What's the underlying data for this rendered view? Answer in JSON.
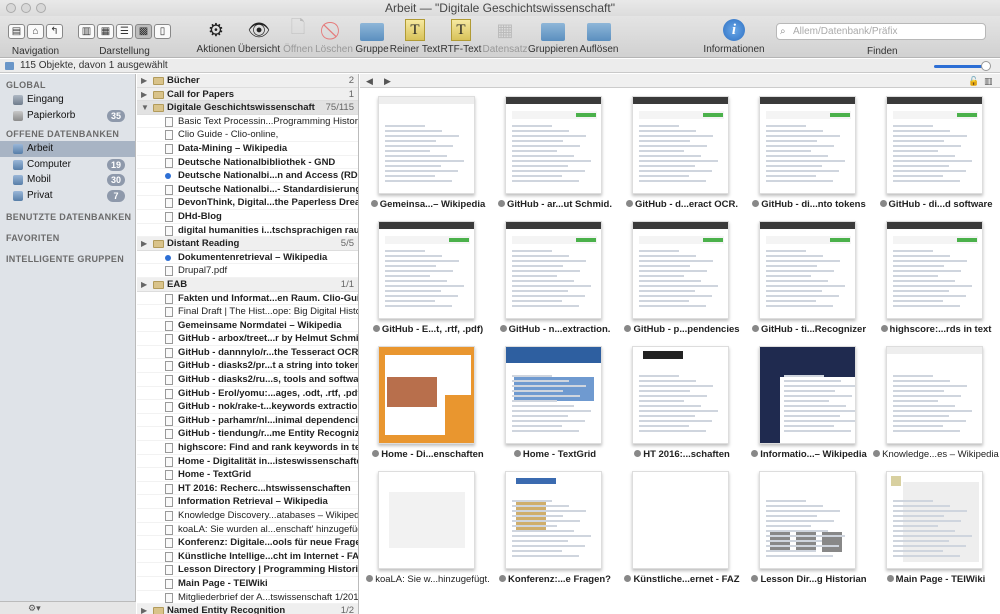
{
  "window": {
    "title": "Arbeit — \"Digitale Geschichtswissenschaft\""
  },
  "toolbar": {
    "navigation": "Navigation",
    "darstellung": "Darstellung",
    "aktionen": "Aktionen",
    "uebersicht": "Übersicht",
    "oeffnen": "Öffnen",
    "loeschen": "Löschen",
    "gruppe": "Gruppe",
    "reiner_text": "Reiner Text",
    "rtf_text": "RTF-Text",
    "datensatz": "Datensatz",
    "gruppieren": "Gruppieren",
    "aufloesen": "Auflösen",
    "informationen": "Informationen",
    "finden": "Finden",
    "search_placeholder": "Allem/Datenbank/Präfix"
  },
  "pathbar": {
    "status": "115 Objekte, davon 1 ausgewählt"
  },
  "sidebar": {
    "global_head": "GLOBAL",
    "global": [
      {
        "label": "Eingang",
        "badge": ""
      },
      {
        "label": "Papierkorb",
        "badge": "35"
      }
    ],
    "offene_head": "OFFENE DATENBANKEN",
    "offene": [
      {
        "label": "Arbeit",
        "badge": ""
      },
      {
        "label": "Computer",
        "badge": "19"
      },
      {
        "label": "Mobil",
        "badge": "30"
      },
      {
        "label": "Privat",
        "badge": "7"
      }
    ],
    "benutzte_head": "BENUTZTE DATENBANKEN",
    "favoriten_head": "FAVORITEN",
    "intelligente_head": "INTELLIGENTE GRUPPEN"
  },
  "list": [
    {
      "label": "Bücher",
      "type": "group",
      "count": "2"
    },
    {
      "label": "Call for Papers",
      "type": "group",
      "count": "1"
    },
    {
      "label": "Digitale Geschichtswissenschaft",
      "type": "group-open",
      "count": "75/115"
    },
    {
      "label": "Basic Text Processin...Programming Historian",
      "type": "doc",
      "bold": false
    },
    {
      "label": "Clio Guide - Clio-online,",
      "type": "doc",
      "bold": false
    },
    {
      "label": "Data-Mining – Wikipedia",
      "type": "doc",
      "bold": true
    },
    {
      "label": "Deutsche Nationalbibliothek - GND",
      "type": "doc",
      "bold": true
    },
    {
      "label": "Deutsche Nationalbi...n and Access (RDA)",
      "type": "dot",
      "bold": true
    },
    {
      "label": "Deutsche Nationalbi...- Standardisierung",
      "type": "doc",
      "bold": true
    },
    {
      "label": "DevonThink, Digital...the Paperless Dream",
      "type": "doc",
      "bold": true
    },
    {
      "label": "DHd-Blog",
      "type": "doc",
      "bold": true
    },
    {
      "label": "digital humanities i...tschsprachigen raum",
      "type": "doc",
      "bold": true
    },
    {
      "label": "Distant Reading",
      "type": "group",
      "count": "5/5"
    },
    {
      "label": "Dokumentenretrieval – Wikipedia",
      "type": "dot",
      "bold": true
    },
    {
      "label": "Drupal7.pdf",
      "type": "doc",
      "bold": false
    },
    {
      "label": "EAB",
      "type": "group",
      "count": "1/1"
    },
    {
      "label": "Fakten und Informat...en Raum. Clio-Guide",
      "type": "doc",
      "bold": true
    },
    {
      "label": "Final Draft | The Hist...ope: Big Digital History",
      "type": "doc",
      "bold": false
    },
    {
      "label": "Gemeinsame Normdatei – Wikipedia",
      "type": "doc",
      "bold": true
    },
    {
      "label": "GitHub - arbox/treet...r by Helmut Schmid.",
      "type": "doc",
      "bold": true
    },
    {
      "label": "GitHub - dannnylo/r...the Tesseract OCR.",
      "type": "doc",
      "bold": true
    },
    {
      "label": "GitHub - diasks2/pr...t a string into tokens",
      "type": "doc",
      "bold": true
    },
    {
      "label": "GitHub - diasks2/ru...s, tools and software",
      "type": "doc",
      "bold": true
    },
    {
      "label": "GitHub - Erol/yomu:...ages, .odt, .rtf, .pdf)",
      "type": "doc",
      "bold": true
    },
    {
      "label": "GitHub - nok/rake-t...keywords extraction.",
      "type": "doc",
      "bold": true
    },
    {
      "label": "GitHub - parhamr/nl...inimal dependencies",
      "type": "doc",
      "bold": true
    },
    {
      "label": "GitHub - tiendung/r...me Entity Recognizer",
      "type": "doc",
      "bold": true
    },
    {
      "label": "highscore: Find and rank keywords in text",
      "type": "doc",
      "bold": true
    },
    {
      "label": "Home - Digitalität in...isteswissenschaften",
      "type": "doc",
      "bold": true
    },
    {
      "label": "Home - TextGrid",
      "type": "doc",
      "bold": true
    },
    {
      "label": "HT 2016: Recherc...htswissenschaften",
      "type": "doc",
      "bold": true
    },
    {
      "label": "Information Retrieval – Wikipedia",
      "type": "doc",
      "bold": true
    },
    {
      "label": "Knowledge Discovery...atabases – Wikipedia",
      "type": "doc",
      "bold": false
    },
    {
      "label": "koaLA: Sie wurden al...enschaft' hinzugefügt.",
      "type": "doc",
      "bold": false
    },
    {
      "label": "Konferenz: Digitale...ools für neue Fragen?",
      "type": "doc",
      "bold": true
    },
    {
      "label": "Künstliche Intellige...cht im Internet - FAZ",
      "type": "doc",
      "bold": true
    },
    {
      "label": "Lesson Directory | Programming Historian",
      "type": "doc",
      "bold": true
    },
    {
      "label": "Main Page - TEIWiki",
      "type": "doc",
      "bold": true
    },
    {
      "label": "Mitgliederbrief der A...tswissenschaft 1/2016",
      "type": "doc",
      "bold": false
    },
    {
      "label": "Named Entity Recognition",
      "type": "group",
      "count": "1/2"
    }
  ],
  "thumbs": [
    {
      "caption": "Gemeinsa...– Wikipedia",
      "bold": true,
      "style": "wiki"
    },
    {
      "caption": "GitHub - ar...ut Schmid.",
      "bold": true,
      "style": "github"
    },
    {
      "caption": "GitHub - d...eract OCR.",
      "bold": true,
      "style": "github"
    },
    {
      "caption": "GitHub - di...nto tokens",
      "bold": true,
      "style": "github"
    },
    {
      "caption": "GitHub - di...d software",
      "bold": true,
      "style": "github"
    },
    {
      "caption": "GitHub - E...t, .rtf, .pdf)",
      "bold": true,
      "style": "github"
    },
    {
      "caption": "GitHub - n...extraction.",
      "bold": true,
      "style": "github"
    },
    {
      "caption": "GitHub - p...pendencies",
      "bold": true,
      "style": "github"
    },
    {
      "caption": "GitHub - ti...Recognizer",
      "bold": true,
      "style": "github"
    },
    {
      "caption": "highscore:...rds in text",
      "bold": true,
      "style": "github"
    },
    {
      "caption": "Home - Di...enschaften",
      "bold": true,
      "style": "orange"
    },
    {
      "caption": "Home - TextGrid",
      "bold": true,
      "style": "textgrid"
    },
    {
      "caption": "HT 2016:...schaften",
      "bold": true,
      "style": "hsoz"
    },
    {
      "caption": "Informatio...– Wikipedia",
      "bold": true,
      "style": "darkwiki"
    },
    {
      "caption": "Knowledge...es – Wikipedia",
      "bold": false,
      "style": "wiki"
    },
    {
      "caption": "koaLA: Sie w...hinzugefügt.",
      "bold": false,
      "style": "mail"
    },
    {
      "caption": "Konferenz:...e Fragen?",
      "bold": true,
      "style": "clarin"
    },
    {
      "caption": "Künstliche...ernet - FAZ",
      "bold": true,
      "style": "blank"
    },
    {
      "caption": "Lesson Dir...g Historian",
      "bold": true,
      "style": "lesson"
    },
    {
      "caption": "Main Page - TEIWiki",
      "bold": true,
      "style": "tei"
    }
  ],
  "bottom": {
    "gear": "⚙▾"
  }
}
